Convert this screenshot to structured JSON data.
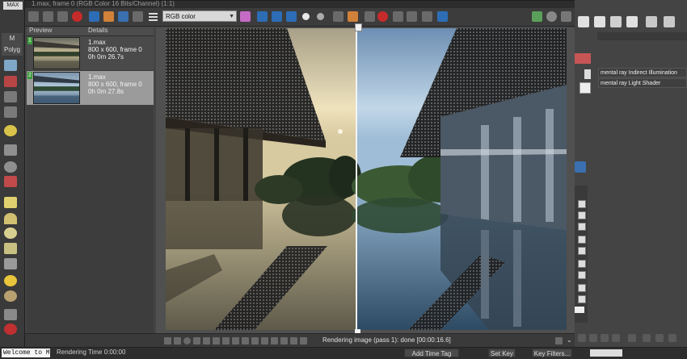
{
  "app": {
    "logo": "MAX",
    "command_tabs": [
      "M",
      "Polyg"
    ]
  },
  "frame_window": {
    "title": "1.max, frame 0 (RGB Color 16 Bits/Channel) (1:1)",
    "toolbar": {
      "channel_select": "RGB color",
      "channel_options": [
        "RGB color"
      ]
    },
    "history": {
      "columns": [
        "Preview",
        "Details"
      ],
      "entries": [
        {
          "num": "1",
          "name": "1.max",
          "size": "800 x 600, frame 0",
          "time": "0h 0m 26.7s",
          "selected": false
        },
        {
          "num": "2",
          "name": "1.max",
          "size": "800 x 600, frame 0",
          "time": "0h 0m 27.8s",
          "selected": true
        }
      ]
    },
    "status_text": "Rendering image (pass 1): done [00:00:16.6]"
  },
  "right_panel": {
    "shaders": [
      "mental ray Indirect Illumination",
      "mental ray Light Shader"
    ]
  },
  "bottom_bar": {
    "welcome": "Welcome to M",
    "rendering_time": "Rendering Time  0:00:00",
    "add_time_tag": "Add Time Tag",
    "set_key": "Set Key",
    "key_filters": "Key Filters..."
  },
  "colors": {
    "accent": "#2d6db5",
    "warm_sky": "#e6d9b4",
    "cool_sky": "#a9c6de"
  }
}
